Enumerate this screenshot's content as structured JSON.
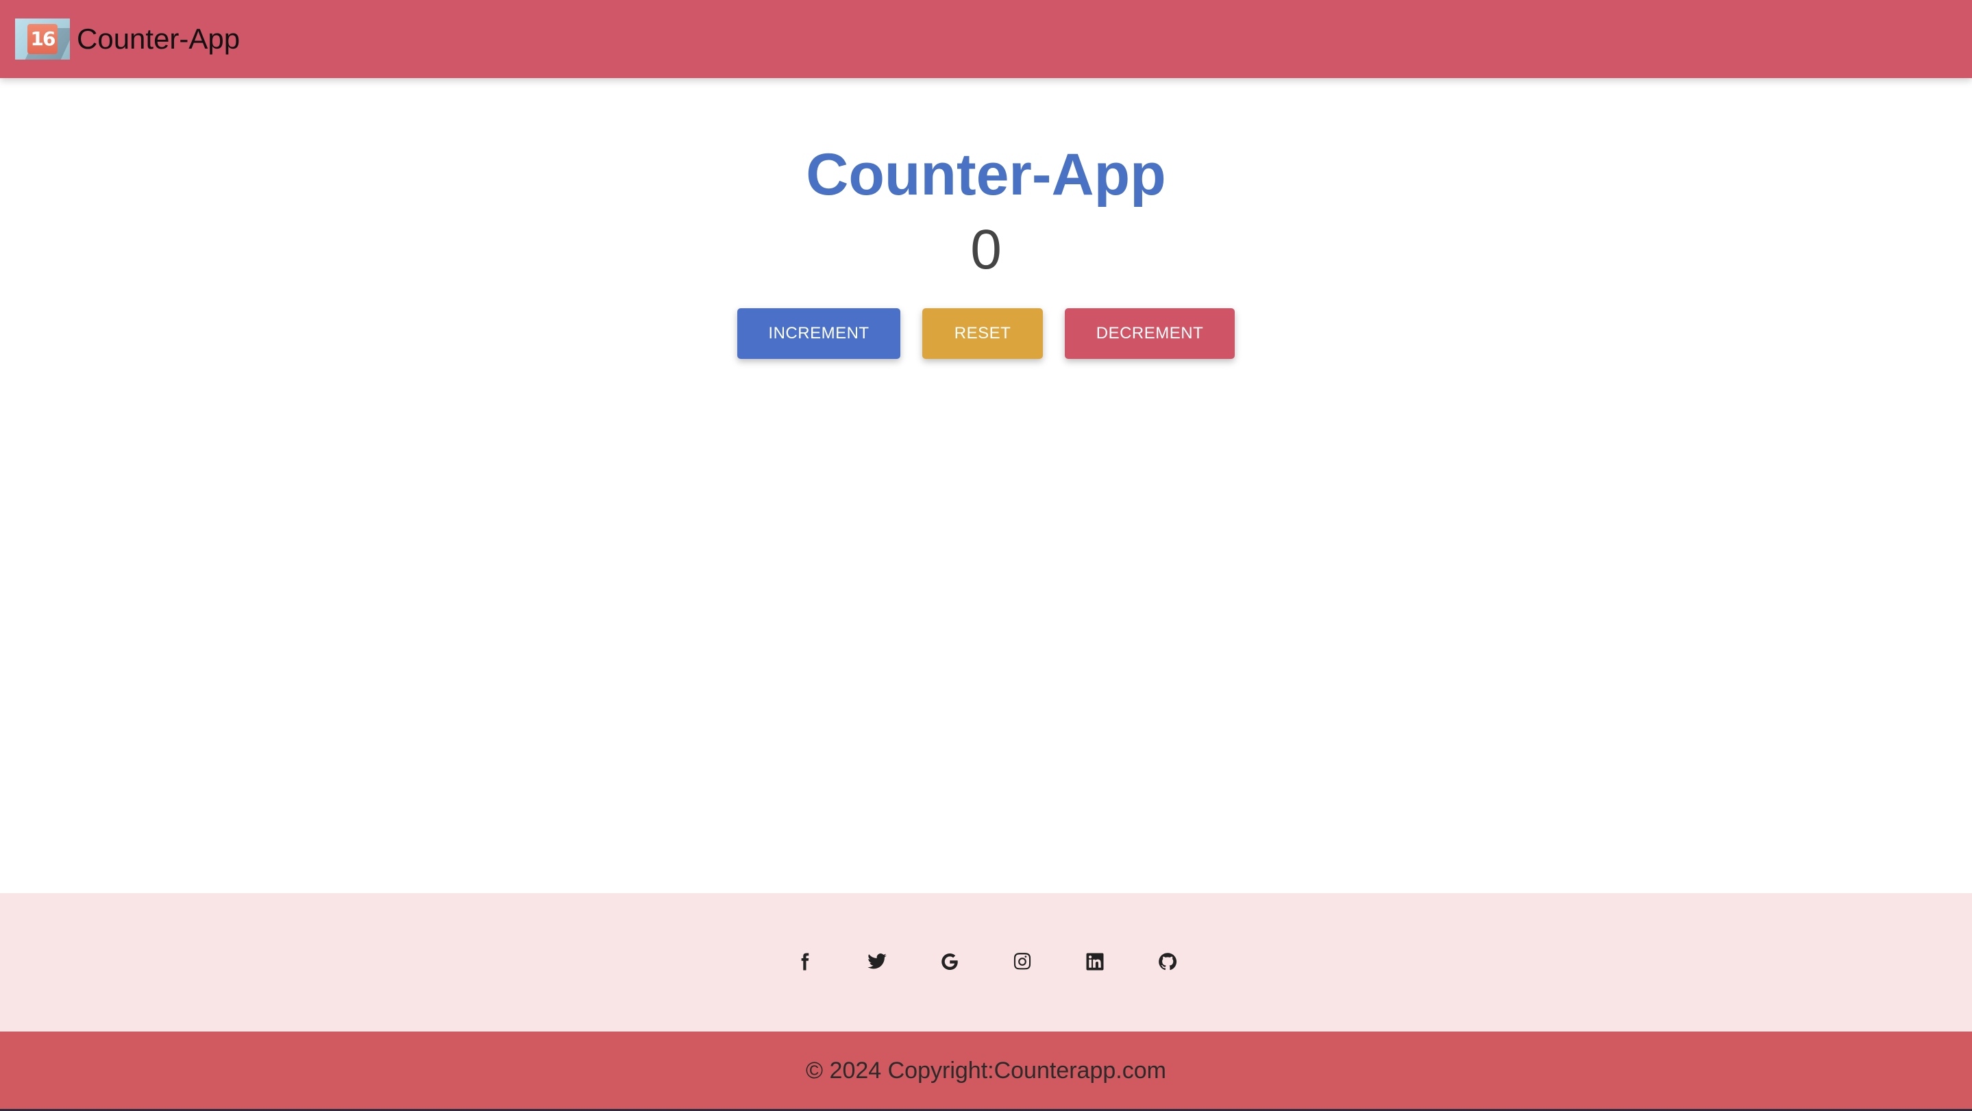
{
  "navbar": {
    "brand_name": "Counter-App",
    "logo_text": "16",
    "background": "#d05767"
  },
  "main": {
    "title": "Counter-App",
    "count": "0",
    "buttons": {
      "increment": "INCREMENT",
      "reset": "RESET",
      "decrement": "DECREMENT"
    },
    "colors": {
      "title": "#4a72c4",
      "increment": "#4a70c8",
      "reset": "#dba43c",
      "decrement": "#cf5566"
    }
  },
  "footer": {
    "social_icons": [
      "facebook-icon",
      "twitter-icon",
      "google-icon",
      "instagram-icon",
      "linkedin-icon",
      "github-icon"
    ],
    "copyright": "© 2024 Copyright:Counterapp.com",
    "social_bg": "#f9e5e6",
    "copyright_bg": "#d05a5f"
  }
}
